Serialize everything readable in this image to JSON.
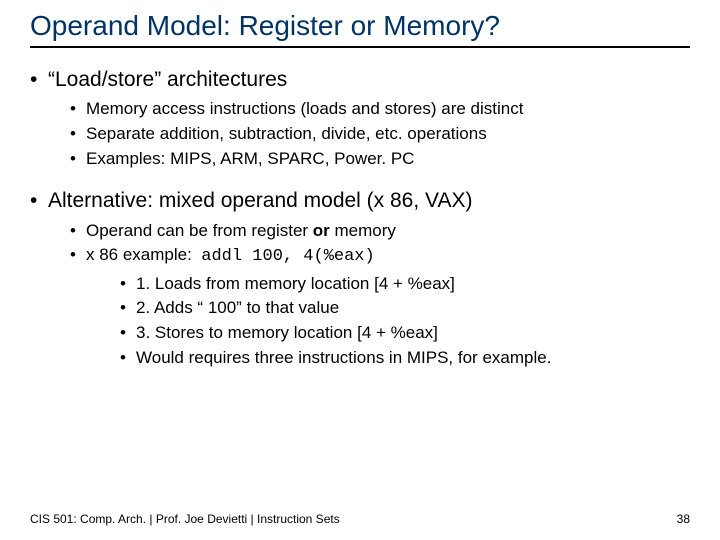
{
  "title": "Operand Model: Register or Memory?",
  "bullets": [
    {
      "text": "“Load/store” architectures",
      "children": [
        {
          "text": "Memory access instructions (loads and stores) are distinct"
        },
        {
          "text": "Separate addition, subtraction, divide, etc. operations"
        },
        {
          "text": "Examples: MIPS, ARM, SPARC, Power. PC"
        }
      ]
    },
    {
      "text": "Alternative: mixed operand model (x 86, VAX)",
      "children": [
        {
          "html": "Operand can be from register <b>or</b> memory"
        },
        {
          "html": "x 86 example:&nbsp; <span class=\"mono\">addl 100, 4(%eax)</span>",
          "children": [
            {
              "text": "1. Loads from memory location [4 + %eax]"
            },
            {
              "text": "2. Adds “ 100” to that value"
            },
            {
              "text": "3. Stores to memory location [4 + %eax]"
            },
            {
              "text": "Would requires three instructions in MIPS, for example."
            }
          ]
        }
      ]
    }
  ],
  "footer": {
    "left": "CIS 501: Comp. Arch.  |  Prof. Joe Devietti  |  Instruction Sets",
    "right": "38"
  }
}
